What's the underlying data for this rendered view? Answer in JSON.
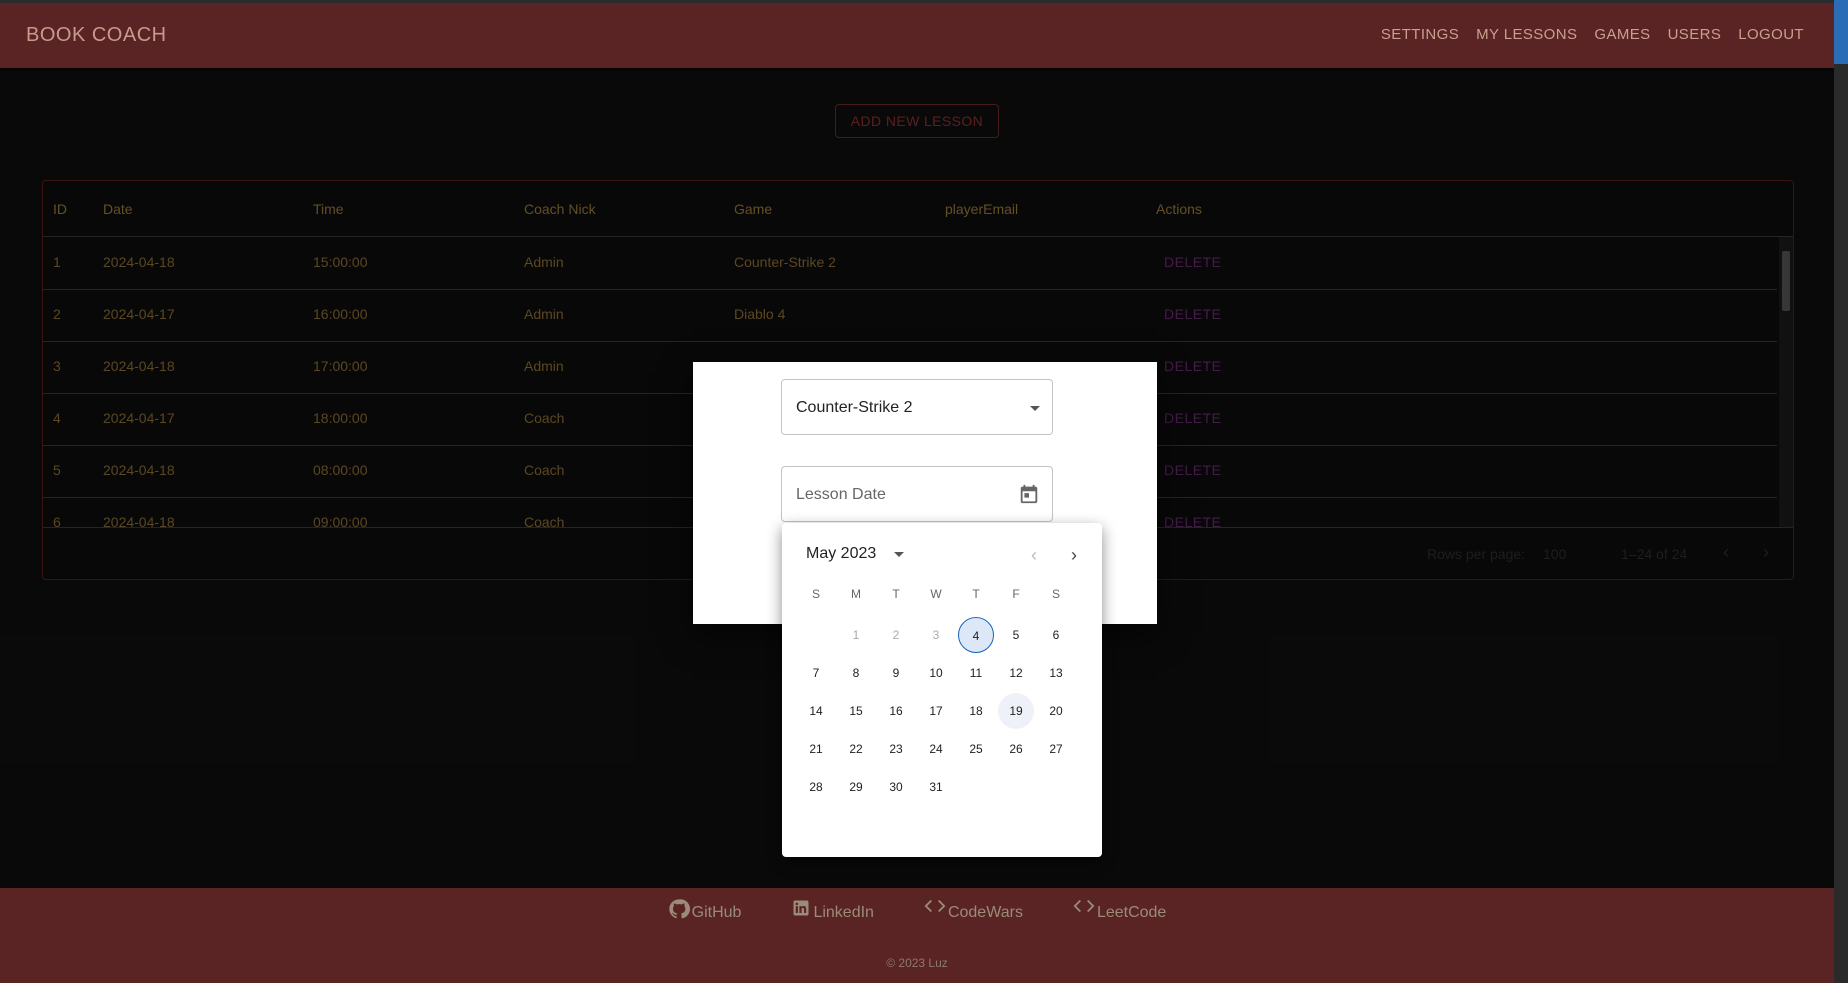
{
  "header": {
    "title": "BOOK COACH",
    "nav": [
      "SETTINGS",
      "MY LESSONS",
      "GAMES",
      "USERS",
      "LOGOUT"
    ]
  },
  "add_button_label": "ADD NEW LESSON",
  "table": {
    "columns": [
      "ID",
      "Date",
      "Time",
      "Coach Nick",
      "Game",
      "playerEmail",
      "Actions"
    ],
    "rows": [
      {
        "id": "1",
        "date": "2024-04-18",
        "time": "15:00:00",
        "coach": "Admin",
        "game": "Counter-Strike 2",
        "email": "",
        "action": "DELETE"
      },
      {
        "id": "2",
        "date": "2024-04-17",
        "time": "16:00:00",
        "coach": "Admin",
        "game": "Diablo 4",
        "email": "",
        "action": "DELETE"
      },
      {
        "id": "3",
        "date": "2024-04-18",
        "time": "17:00:00",
        "coach": "Admin",
        "game": "",
        "email": "",
        "action": "DELETE"
      },
      {
        "id": "4",
        "date": "2024-04-17",
        "time": "18:00:00",
        "coach": "Coach",
        "game": "",
        "email": "",
        "action": "DELETE"
      },
      {
        "id": "5",
        "date": "2024-04-18",
        "time": "08:00:00",
        "coach": "Coach",
        "game": "",
        "email": "",
        "action": "DELETE"
      },
      {
        "id": "6",
        "date": "2024-04-18",
        "time": "09:00:00",
        "coach": "Coach",
        "game": "",
        "email": "",
        "action": "DELETE"
      }
    ],
    "footer": {
      "rows_per_page_label": "Rows per page:",
      "rows_per_page_value": "100",
      "range": "1–24 of 24"
    }
  },
  "modal": {
    "game_select_value": "Counter-Strike 2",
    "date_placeholder": "Lesson Date"
  },
  "calendar": {
    "month_label": "May 2023",
    "weekdays": [
      "S",
      "M",
      "T",
      "W",
      "T",
      "F",
      "S"
    ],
    "days": [
      {
        "d": "1",
        "disabled": true
      },
      {
        "d": "2",
        "disabled": true
      },
      {
        "d": "3",
        "disabled": true
      },
      {
        "d": "4",
        "today": true
      },
      {
        "d": "5"
      },
      {
        "d": "6"
      },
      {
        "d": "7"
      },
      {
        "d": "8"
      },
      {
        "d": "9"
      },
      {
        "d": "10"
      },
      {
        "d": "11"
      },
      {
        "d": "12"
      },
      {
        "d": "13"
      },
      {
        "d": "14"
      },
      {
        "d": "15"
      },
      {
        "d": "16"
      },
      {
        "d": "17"
      },
      {
        "d": "18"
      },
      {
        "d": "19",
        "hover": true
      },
      {
        "d": "20"
      },
      {
        "d": "21"
      },
      {
        "d": "22"
      },
      {
        "d": "23"
      },
      {
        "d": "24"
      },
      {
        "d": "25"
      },
      {
        "d": "26"
      },
      {
        "d": "27"
      },
      {
        "d": "28"
      },
      {
        "d": "29"
      },
      {
        "d": "30"
      },
      {
        "d": "31"
      }
    ]
  },
  "footer": {
    "links": [
      {
        "icon": "github-icon",
        "label": "GitHub"
      },
      {
        "icon": "linkedin-icon",
        "label": "LinkedIn"
      },
      {
        "icon": "code-icon",
        "label": "CodeWars"
      },
      {
        "icon": "code-icon",
        "label": "LeetCode"
      }
    ],
    "copyright": "© 2023 Luz"
  }
}
